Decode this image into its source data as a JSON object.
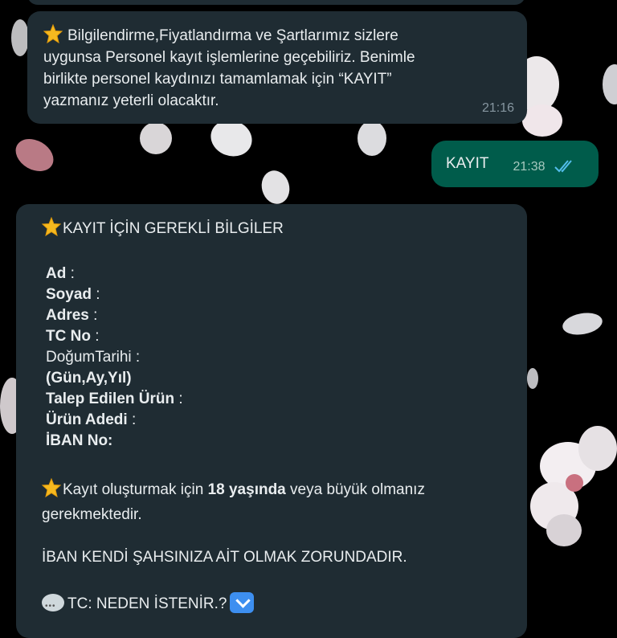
{
  "messages": [
    {
      "direction": "incoming",
      "lines": [
        "Bilgilendirme,Fiyatlandırma ve Şartlarımız sizlere",
        "uygunsa Personel kayıt işlemlerine geçebiliriz. Benimle",
        "birlikte personel kaydınızı tamamlamak için “KAYIT”",
        "yazmanız yeterli olacaktır."
      ],
      "time": "21:16",
      "icon": "star-emoji"
    },
    {
      "direction": "outgoing",
      "text": "KAYIT",
      "time": "21:38",
      "status_icon": "double-check-icon"
    },
    {
      "direction": "incoming",
      "heading": "KAYIT İÇİN GEREKLİ BİLGİLER",
      "fields": [
        {
          "label": "Ad",
          "rest": " :"
        },
        {
          "label": "Soyad",
          "rest": " :"
        },
        {
          "label": "Adres",
          "rest": " :"
        },
        {
          "label": "TC No",
          "rest": " :"
        }
      ],
      "birth_label": "DoğumTarihi :",
      "birth_format": "(Gün,Ay,Yıl)",
      "fields2": [
        {
          "label": "Talep Edilen Ürün",
          "rest": " :"
        },
        {
          "label": "Ürün Adedi",
          "rest": " :"
        },
        {
          "label": "İBAN No:",
          "rest": ""
        }
      ],
      "age_note_pre": "Kayıt oluşturmak için ",
      "age_note_bold": "18 yaşında",
      "age_note_post": " veya büyük olmanız",
      "age_note_line2": "gerekmektedir.",
      "iban_note": "İBAN KENDİ ŞAHSINIZA AİT OLMAK ZORUNDADIR.",
      "tc_question": "TC: NEDEN İSTENİR.?",
      "icons": [
        "star-emoji",
        "speech-bubble-emoji",
        "down-arrow-emoji"
      ]
    }
  ],
  "colors": {
    "incoming_bubble": "#1f2c33",
    "outgoing_bubble": "#005c4b",
    "read_ticks": "#53bdeb",
    "background": "#000000"
  }
}
